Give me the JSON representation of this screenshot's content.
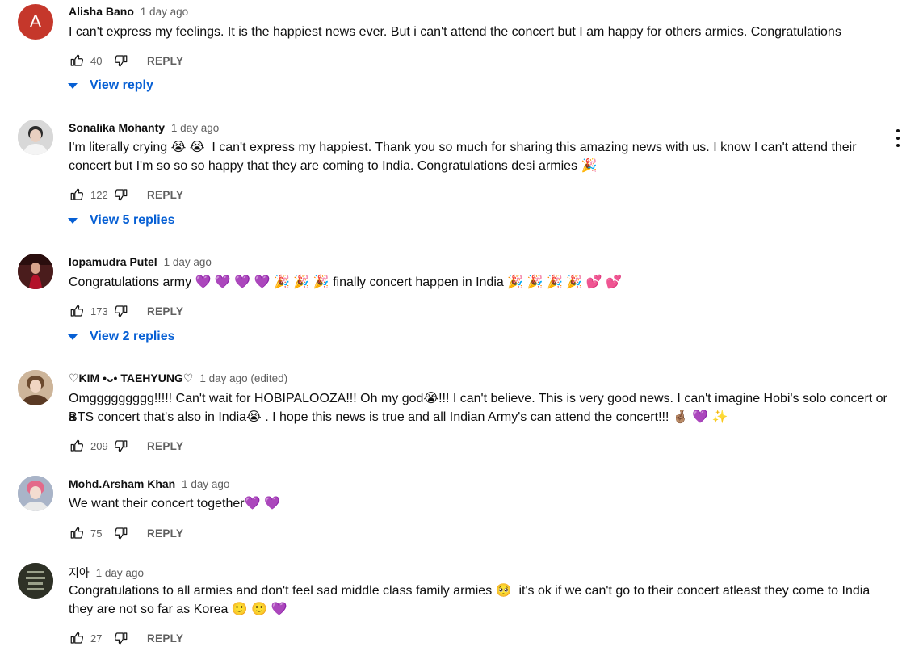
{
  "labels": {
    "reply": "REPLY"
  },
  "comments": [
    {
      "author": "Alisha Bano",
      "time": "1 day ago",
      "avatar_letter": "A",
      "lines": [
        "I can't express my feelings. It is the happiest news ever. But i can't attend the concert but I am happy for others armies. Congratulations"
      ],
      "likes": "40",
      "replies_label": "View reply"
    },
    {
      "author": "Sonalika Mohanty",
      "time": "1 day ago",
      "lines": [
        "I'm literally crying 😭 😭  I can't express my happiest. Thank you so much for sharing this amazing news with us. I know I can't attend their",
        "concert but I'm so so so happy that they are coming to India. Congratulations desi armies 🎉"
      ],
      "likes": "122",
      "replies_label": "View 5 replies"
    },
    {
      "author": "lopamudra Putel",
      "time": "1 day ago",
      "lines": [
        "Congratulations army 💜 💜 💜 💜 🎉 🎉 🎉 finally concert happen in India 🎉 🎉 🎉 🎉 💕 💕"
      ],
      "likes": "173",
      "replies_label": "View 2 replies"
    },
    {
      "author": "♡KIM •ᴗ• TAEHYUNG♡",
      "time": "1 day ago (edited)",
      "lines": [
        "Omggggggggg!!!!! Can't wait for HOBIPALOOZA!!! Oh my god😭!!! I can't believe. This is very good news. I can't imagine Hobi's solo concert or a",
        "BTS concert that's also in India😭 . I hope this news is true and all Indian Army's can attend the concert!!! 🤞🏽 💜 ✨"
      ],
      "likes": "209"
    },
    {
      "author": "Mohd.Arsham Khan",
      "time": "1 day ago",
      "lines": [
        "We want their concert together💜 💜"
      ],
      "likes": "75"
    },
    {
      "author": "지아",
      "time": "1 day ago",
      "lines": [
        "Congratulations to all armies and don't feel sad middle class family armies 🥺  it's ok if we can't go to their concert atleast they come to India",
        "they are not so far as Korea 🙂 🙂 💜"
      ],
      "likes": "27"
    }
  ],
  "colors": {
    "link": "#065fd4",
    "muted": "#606060",
    "avatar_a": "#c5372b"
  }
}
